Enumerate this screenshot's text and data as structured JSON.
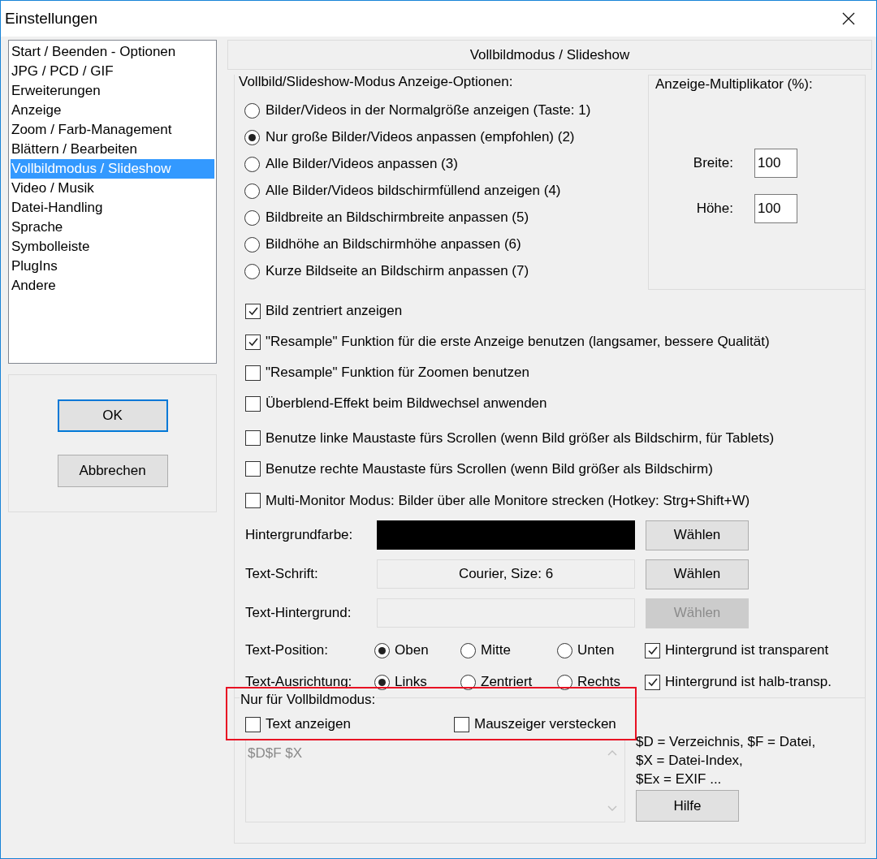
{
  "window": {
    "title": "Einstellungen"
  },
  "sidebar": {
    "items": [
      {
        "label": "Start / Beenden - Optionen",
        "selected": false
      },
      {
        "label": "JPG / PCD / GIF",
        "selected": false
      },
      {
        "label": "Erweiterungen",
        "selected": false
      },
      {
        "label": "Anzeige",
        "selected": false
      },
      {
        "label": "Zoom / Farb-Management",
        "selected": false
      },
      {
        "label": "Blättern / Bearbeiten",
        "selected": false
      },
      {
        "label": "Vollbildmodus / Slideshow",
        "selected": true
      },
      {
        "label": "Video / Musik",
        "selected": false
      },
      {
        "label": "Datei-Handling",
        "selected": false
      },
      {
        "label": "Sprache",
        "selected": false
      },
      {
        "label": "Symbolleiste",
        "selected": false
      },
      {
        "label": "PlugIns",
        "selected": false
      },
      {
        "label": "Andere",
        "selected": false
      }
    ]
  },
  "dialog_buttons": [
    {
      "label": "OK",
      "default": true
    },
    {
      "label": "Abbrechen",
      "default": false
    }
  ],
  "page_header": "Vollbildmodus / Slideshow",
  "display_options": {
    "title": "Vollbild/Slideshow-Modus Anzeige-Optionen:",
    "options": [
      {
        "label": "Bilder/Videos in der Normalgröße anzeigen (Taste: 1)",
        "selected": false
      },
      {
        "label": "Nur große Bilder/Videos anpassen (empfohlen) (2)",
        "selected": true
      },
      {
        "label": "Alle Bilder/Videos anpassen (3)",
        "selected": false
      },
      {
        "label": "Alle Bilder/Videos bildschirmfüllend anzeigen (4)",
        "selected": false
      },
      {
        "label": "Bildbreite an Bildschirmbreite anpassen (5)",
        "selected": false
      },
      {
        "label": "Bildhöhe an Bildschirmhöhe anpassen (6)",
        "selected": false
      },
      {
        "label": "Kurze Bildseite an Bildschirm anpassen (7)",
        "selected": false
      }
    ]
  },
  "multiplier": {
    "title": "Anzeige-Multiplikator (%):",
    "fields": [
      {
        "label": "Breite:",
        "value": "100"
      },
      {
        "label": "Höhe:",
        "value": "100"
      }
    ]
  },
  "checkboxes": [
    {
      "label": "Bild zentriert anzeigen",
      "checked": true
    },
    {
      "label": "\"Resample\" Funktion für die erste Anzeige benutzen (langsamer, bessere Qualität)",
      "checked": true
    },
    {
      "label": "\"Resample\" Funktion für Zoomen benutzen",
      "checked": false
    },
    {
      "label": "Überblend-Effekt beim Bildwechsel anwenden",
      "checked": false
    },
    {
      "label": "Benutze linke Maustaste fürs Scrollen (wenn Bild größer als Bildschirm, für Tablets)",
      "checked": false
    },
    {
      "label": "Benutze rechte Maustaste fürs Scrollen (wenn Bild größer als Bildschirm)",
      "checked": false
    },
    {
      "label": "Multi-Monitor Modus: Bilder über alle Monitore strecken (Hotkey: Strg+Shift+W)",
      "checked": false
    }
  ],
  "style_rows": [
    {
      "label": "Hintergrundfarbe:",
      "kind": "swatch",
      "color": "#000000",
      "button": {
        "label": "Wählen",
        "disabled": false
      }
    },
    {
      "label": "Text-Schrift:",
      "kind": "text",
      "value": "Courier, Size: 6",
      "button": {
        "label": "Wählen",
        "disabled": false
      }
    },
    {
      "label": "Text-Hintergrund:",
      "kind": "empty",
      "button": {
        "label": "Wählen",
        "disabled": true
      }
    }
  ],
  "text_rows": [
    {
      "label": "Text-Position:",
      "options": [
        {
          "label": "Oben",
          "selected": true
        },
        {
          "label": "Mitte",
          "selected": false
        },
        {
          "label": "Unten",
          "selected": false
        }
      ],
      "checkbox": {
        "label": "Hintergrund ist transparent",
        "checked": true
      }
    },
    {
      "label": "Text-Ausrichtung:",
      "options": [
        {
          "label": "Links",
          "selected": true
        },
        {
          "label": "Zentriert",
          "selected": false
        },
        {
          "label": "Rechts",
          "selected": false
        }
      ],
      "checkbox": {
        "label": "Hintergrund ist halb-transp.",
        "checked": true
      }
    }
  ],
  "fullscreen_only": {
    "title": "Nur für Vollbildmodus:",
    "checkboxes": [
      {
        "label": "Text anzeigen",
        "checked": false
      },
      {
        "label": "Mauszeiger verstecken",
        "checked": false
      }
    ],
    "template": "$D$F $X",
    "help_lines": [
      "$D = Verzeichnis, $F = Datei,",
      "$X = Datei-Index,",
      "$Ex = EXIF ..."
    ],
    "help_button": "Hilfe"
  }
}
